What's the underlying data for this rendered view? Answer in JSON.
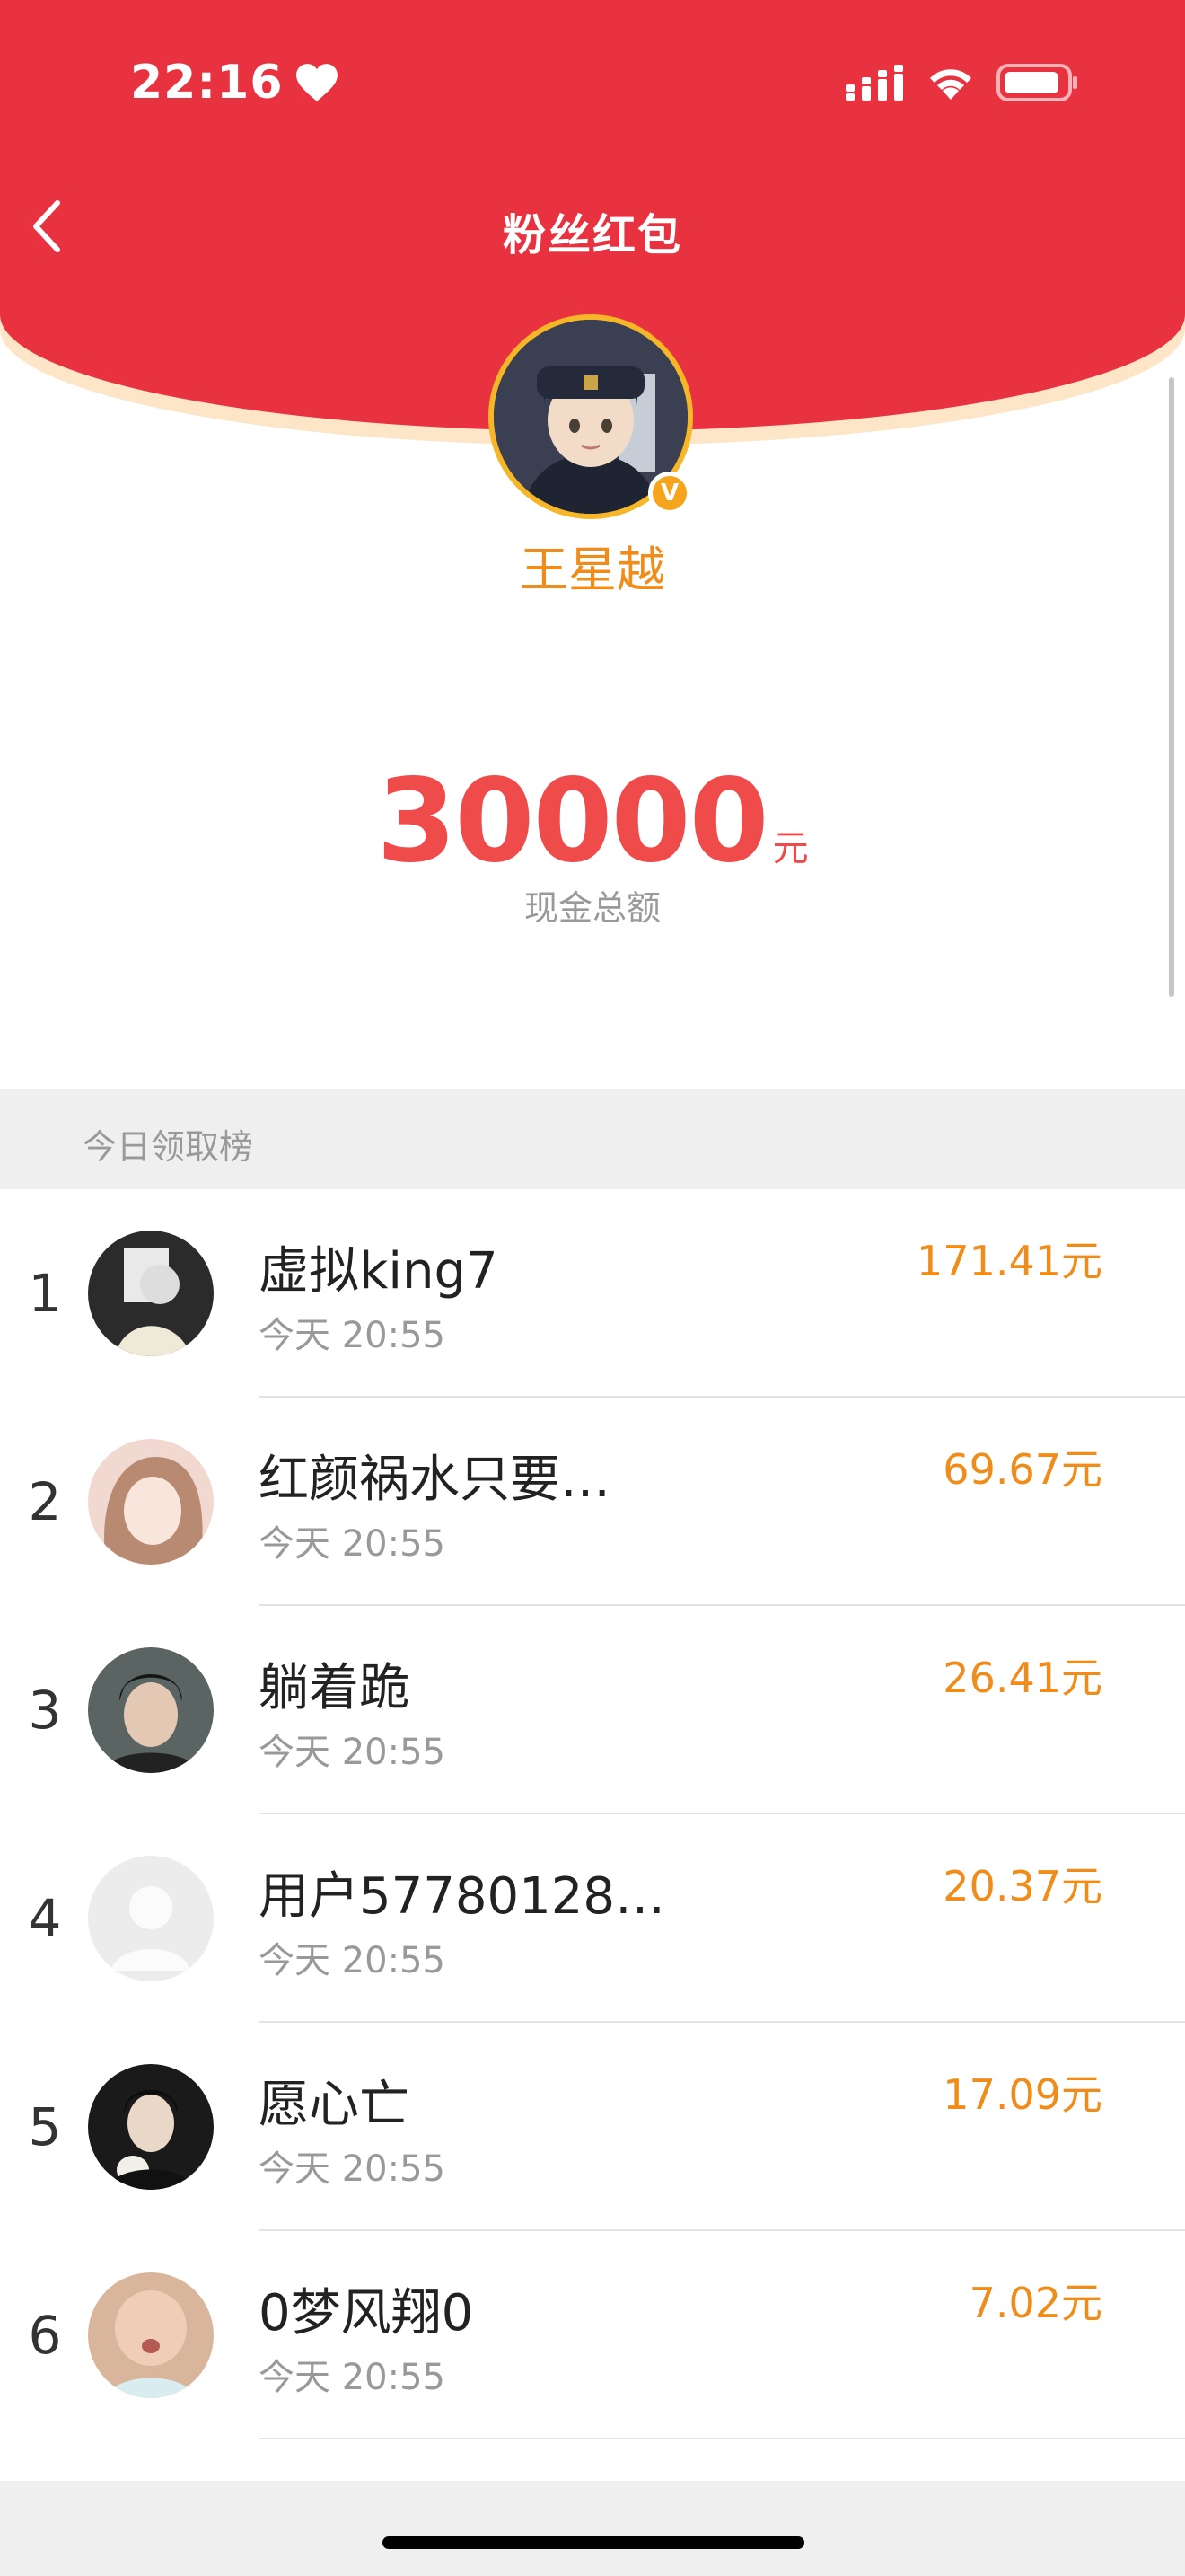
{
  "status_bar": {
    "time": "22:16"
  },
  "nav": {
    "title": "粉丝红包",
    "back_icon": "chevron-left-icon"
  },
  "creator": {
    "name": "王星越",
    "verified_badge": "V"
  },
  "cash": {
    "amount": "30000",
    "unit": "元",
    "caption": "现金总额"
  },
  "section": {
    "title": "今日领取榜"
  },
  "ranking": [
    {
      "rank": "1",
      "name": "虚拟king7",
      "time": "今天 20:55",
      "amount": "171.41元"
    },
    {
      "rank": "2",
      "name": "红颜祸水只要…",
      "time": "今天 20:55",
      "amount": "69.67元"
    },
    {
      "rank": "3",
      "name": "躺着跪",
      "time": "今天 20:55",
      "amount": "26.41元"
    },
    {
      "rank": "4",
      "name": "用户57780128…",
      "time": "今天 20:55",
      "amount": "20.37元"
    },
    {
      "rank": "5",
      "name": "愿心亡",
      "time": "今天 20:55",
      "amount": "17.09元"
    },
    {
      "rank": "6",
      "name": "0梦风翔0",
      "time": "今天 20:55",
      "amount": "7.02元"
    }
  ],
  "colors": {
    "header_red": "#e8323f",
    "amount_red": "#ef4b4b",
    "accent_orange": "#f08c1a"
  }
}
